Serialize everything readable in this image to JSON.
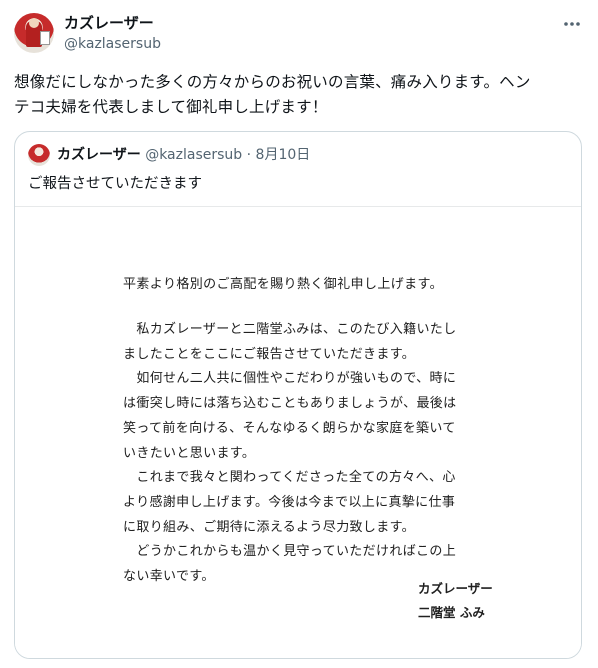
{
  "post": {
    "author_name": "カズレーザー",
    "author_handle": "@kazlasersub",
    "more_icon": "more-horizontal-icon",
    "text": "想像だにしなかった多くの方々からのお祝いの言葉、痛み入ります。ヘン\nテコ夫婦を代表しまして御礼申し上げます！"
  },
  "quote": {
    "author_name": "カズレーザー",
    "author_handle": "@kazlasersub",
    "separator": "·",
    "date": "8月10日",
    "text": "ご報告させていただきます",
    "letter": {
      "greeting": "平素より格別のご高配を賜り熱く御礼申し上げます。",
      "body": "　私カズレーザーと二階堂ふみは、このたび入籍いたし\nましたことをここにご報告させていただきます。\n　如何せん二人共に個性やこだわりが強いもので、時に\nは衝突し時には落ち込むこともありましょうが、最後は\n笑って前を向ける、そんなゆるく朗らかな家庭を築いて\nいきたいと思います。\n　これまで我々と関わってくださった全ての方々へ、心\nより感謝申し上げます。今後は今まで以上に真摯に仕事\nに取り組み、ご期待に添えるよう尽力致します。\n　どうかこれからも温かく見守っていただければこの上\nない幸いです。",
      "signature_1": "カズレーザー",
      "signature_2": "二階堂 ふみ"
    }
  }
}
